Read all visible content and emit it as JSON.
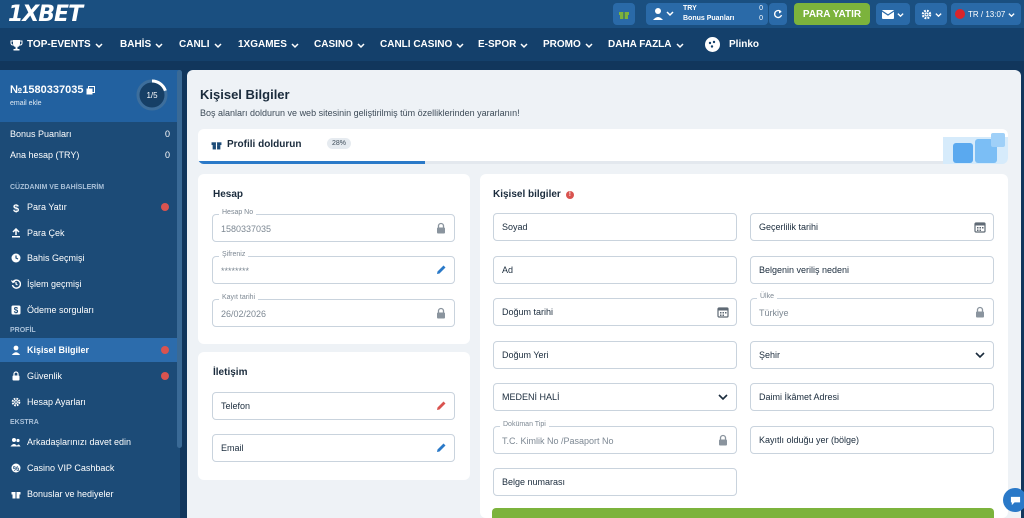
{
  "header": {
    "logo": "1XBET",
    "account": {
      "currency": "TRY",
      "bonus_label": "Bonus Puanları",
      "balance": "0",
      "bonus_value": "0"
    },
    "deposit_label": "PARA YATIR",
    "lang_time": "TR / 13:07",
    "accent_color": "#7cb33c"
  },
  "nav": {
    "items": [
      {
        "label": "TOP-EVENTS",
        "icon": "trophy-icon"
      },
      {
        "label": "BAHİS"
      },
      {
        "label": "CANLI"
      },
      {
        "label": "1XGAMES"
      },
      {
        "label": "CASINO"
      },
      {
        "label": "CANLI CASINO"
      },
      {
        "label": "E-SPOR"
      },
      {
        "label": "PROMO"
      },
      {
        "label": "DAHA FAZLA"
      },
      {
        "label": "Plinko",
        "icon": "plinko-icon"
      }
    ]
  },
  "sidebar": {
    "account_no": "№1580337035",
    "email_add": "email ekle",
    "progress": "1/5",
    "progress_fraction": 0.2,
    "bonus_points_label": "Bonus Puanları",
    "bonus_points_value": "0",
    "main_account_label": "Ana hesap (TRY)",
    "main_account_value": "0",
    "section_wallet": "CÜZDANIM VE BAHİSLERİM",
    "wallet_items": [
      "Para Yatır",
      "Para Çek",
      "Bahis Geçmişi",
      "İşlem geçmişi",
      "Ödeme sorguları"
    ],
    "section_profile": "PROFİL",
    "profile_items": [
      "Kişisel Bilgiler",
      "Güvenlik",
      "Hesap Ayarları"
    ],
    "section_extra": "EKSTRA",
    "extra_items": [
      "Arkadaşlarınızı davet edin",
      "Casino VIP Cashback",
      "Bonuslar ve hediyeler"
    ]
  },
  "main": {
    "title": "Kişisel Bilgiler",
    "subtitle": "Boş alanları doldurun ve web sitesinin geliştirilmiş tüm özelliklerinden yararlanın!",
    "profile_fill_label": "Profili doldurun",
    "profile_fill_pct": "28%",
    "profile_fill_fraction": 0.28,
    "account_card": {
      "title": "Hesap",
      "account_no_label": "Hesap No",
      "account_no_value": "1580337035",
      "password_label": "Şifreniz",
      "password_value": "********",
      "reg_date_label": "Kayıt tarihi",
      "reg_date_value": "26/02/2026"
    },
    "contact_card": {
      "title": "İletişim",
      "phone": "Telefon",
      "email": "Email"
    },
    "personal_card": {
      "title": "Kişisel bilgiler",
      "surname": "Soyad",
      "validity_date": "Geçerlilik tarihi",
      "name": "Ad",
      "doc_reason": "Belgenin veriliş nedeni",
      "birth_date": "Doğum tarihi",
      "country_label": "Ülke",
      "country_value": "Türkiye",
      "birth_place": "Doğum Yeri",
      "city": "Şehir",
      "marital": "MEDENİ HALİ",
      "address": "Daimi İkâmet Adresi",
      "doc_type_label": "Doküman Tipi",
      "doc_type_value": "T.C. Kimlik No /Pasaport No",
      "registered_place": "Kayıtlı olduğu yer (bölge)",
      "doc_number": "Belge numarası"
    }
  }
}
